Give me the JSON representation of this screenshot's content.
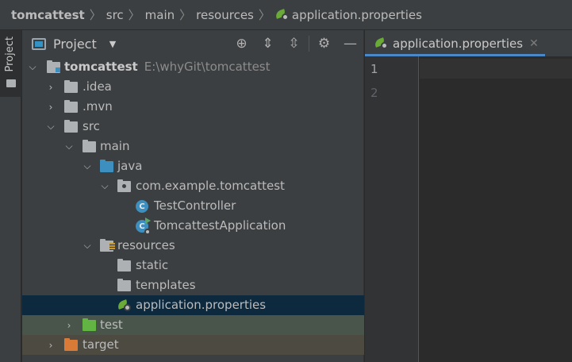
{
  "breadcrumb": [
    "tomcattest",
    "src",
    "main",
    "resources",
    "application.properties"
  ],
  "side_strip": {
    "label": "Project"
  },
  "project_panel": {
    "title": "Project",
    "toolbar_icons": [
      "locate-icon",
      "expand-all-icon",
      "collapse-all-icon",
      "gear-icon",
      "hide-icon"
    ],
    "tree": [
      {
        "label": "tomcattest",
        "path": "E:\\whyGit\\tomcattest",
        "depth": 0,
        "expanded": true,
        "icon": "module-folder-icon"
      },
      {
        "label": ".idea",
        "depth": 1,
        "expanded": false,
        "icon": "folder-icon"
      },
      {
        "label": ".mvn",
        "depth": 1,
        "expanded": false,
        "icon": "folder-icon"
      },
      {
        "label": "src",
        "depth": 1,
        "expanded": true,
        "icon": "folder-icon"
      },
      {
        "label": "main",
        "depth": 2,
        "expanded": true,
        "icon": "folder-icon"
      },
      {
        "label": "java",
        "depth": 3,
        "expanded": true,
        "icon": "source-folder-icon"
      },
      {
        "label": "com.example.tomcattest",
        "depth": 4,
        "expanded": true,
        "icon": "package-icon"
      },
      {
        "label": "TestController",
        "depth": 5,
        "icon": "class-icon"
      },
      {
        "label": "TomcattestApplication",
        "depth": 5,
        "icon": "spring-boot-class-icon"
      },
      {
        "label": "resources",
        "depth": 3,
        "expanded": true,
        "icon": "resources-folder-icon"
      },
      {
        "label": "static",
        "depth": 4,
        "icon": "folder-icon"
      },
      {
        "label": "templates",
        "depth": 4,
        "icon": "folder-icon"
      },
      {
        "label": "application.properties",
        "depth": 4,
        "icon": "spring-properties-icon",
        "selected": true
      },
      {
        "label": "test",
        "depth": 2,
        "expanded": false,
        "icon": "test-folder-icon"
      },
      {
        "label": "target",
        "depth": 1,
        "expanded": false,
        "icon": "excluded-folder-icon"
      }
    ]
  },
  "editor": {
    "tab_label": "application.properties",
    "line_numbers": [
      "1",
      "2"
    ]
  },
  "colors": {
    "selection": "#0d293e",
    "test_row": "#49544a",
    "target_row": "#4c4a41",
    "tab_accent": "#4a88c7"
  }
}
